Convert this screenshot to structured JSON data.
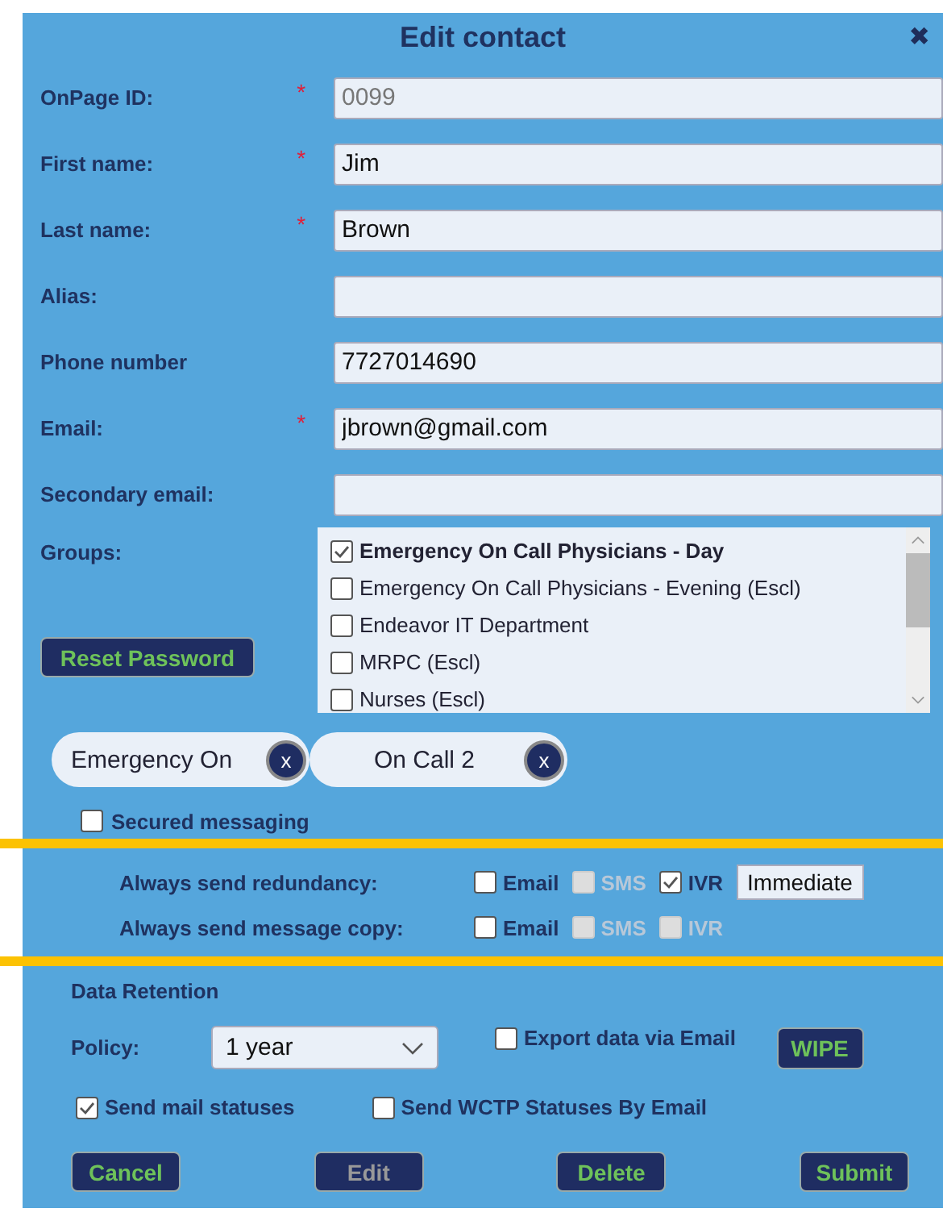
{
  "dialog": {
    "title": "Edit contact",
    "close": "✖"
  },
  "fields": [
    {
      "label": "OnPage ID:",
      "required": true,
      "placeholder": "0099"
    },
    {
      "label": "First name:",
      "required": true,
      "value": "Jim"
    },
    {
      "label": "Last name:",
      "required": true,
      "value": "Brown"
    },
    {
      "label": "Alias:",
      "required": false
    },
    {
      "label": "Phone number",
      "required": false,
      "value": "7727014690"
    },
    {
      "label": "Email:",
      "required": true,
      "value": "jbrown@gmail.com"
    },
    {
      "label": "Secondary email:",
      "required": false
    }
  ],
  "required_mark": "*",
  "groups": {
    "label": "Groups:",
    "items": [
      {
        "label": "Emergency On Call Physicians - Day",
        "checked": true
      },
      {
        "label": "Emergency On Call Physicians - Evening (Escl)",
        "checked": false
      },
      {
        "label": "Endeavor IT Department",
        "checked": false
      },
      {
        "label": "MRPC (Escl)",
        "checked": false
      },
      {
        "label": "Nurses (Escl)",
        "checked": false
      }
    ]
  },
  "reset_password": "Reset Password",
  "chips": [
    {
      "label": "Emergency On",
      "remove": "x"
    },
    {
      "label": "On Call 2",
      "remove": "x"
    }
  ],
  "secured_messaging": {
    "label": "Secured messaging",
    "checked": false
  },
  "delivery": [
    {
      "label": "Always send redundancy:",
      "options": [
        {
          "label": "Email",
          "checked": false,
          "disabled": false
        },
        {
          "label": "SMS",
          "checked": false,
          "disabled": true
        },
        {
          "label": "IVR",
          "checked": true,
          "disabled": false
        }
      ],
      "button": "Immediate"
    },
    {
      "label": "Always send message copy:",
      "options": [
        {
          "label": "Email",
          "checked": false,
          "disabled": false
        },
        {
          "label": "SMS",
          "checked": false,
          "disabled": true
        },
        {
          "label": "IVR",
          "checked": false,
          "disabled": true
        }
      ]
    }
  ],
  "retention": {
    "heading": "Data Retention",
    "policy_label": "Policy:",
    "policy": "1 year",
    "export": {
      "label": "Export data via Email",
      "checked": false
    },
    "wipe": "WIPE"
  },
  "statuses": [
    {
      "label": "Send mail statuses",
      "checked": true
    },
    {
      "label": "Send WCTP Statuses By Email",
      "checked": false
    }
  ],
  "actions": [
    {
      "label": "Cancel",
      "disabled": false
    },
    {
      "label": "Edit",
      "disabled": true
    },
    {
      "label": "Delete",
      "disabled": false
    },
    {
      "label": "Submit",
      "disabled": false
    }
  ]
}
